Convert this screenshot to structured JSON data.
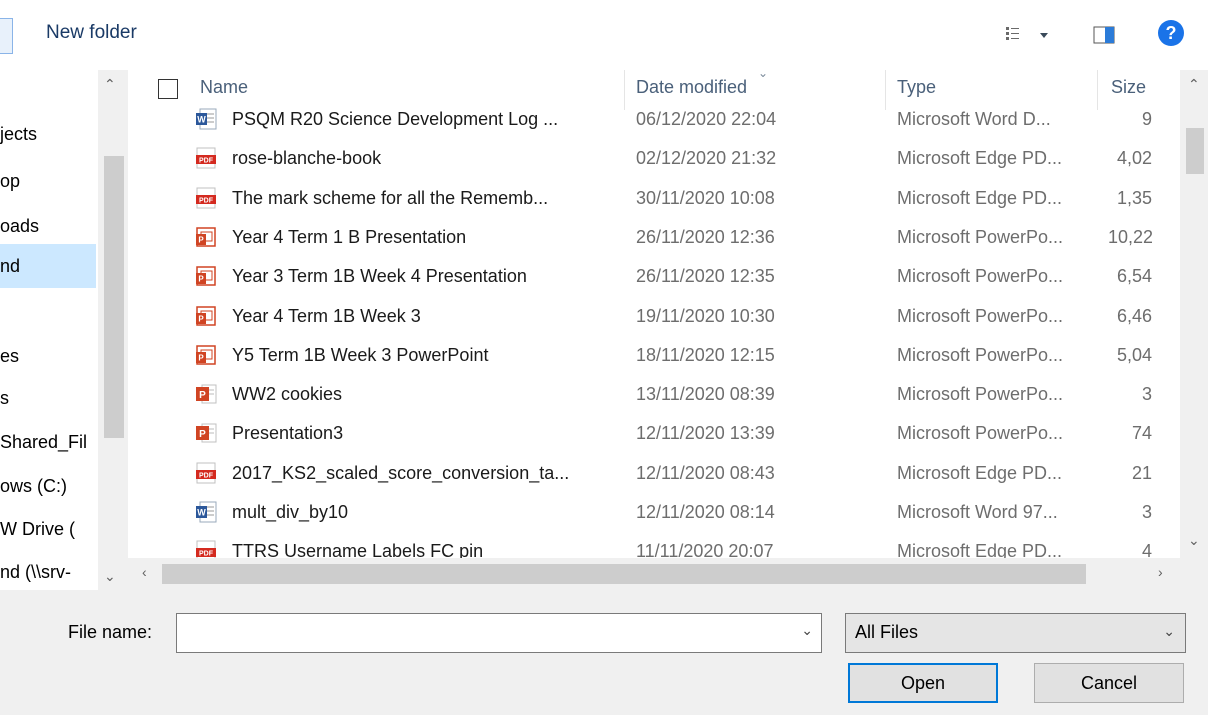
{
  "toolbar": {
    "new_folder_label": "New folder",
    "view_icon": "details-view-icon",
    "preview_icon": "preview-pane-icon",
    "help_icon": "help-icon",
    "help_glyph": "?"
  },
  "nav": {
    "items": [
      {
        "label": "jects",
        "selected": false
      },
      {
        "label": "op",
        "selected": false
      },
      {
        "label": "oads",
        "selected": false
      },
      {
        "label": "nd",
        "selected": true
      },
      {
        "label": "",
        "selected": false
      },
      {
        "label": "es",
        "selected": false
      },
      {
        "label": "s",
        "selected": false
      },
      {
        "label": "Shared_Fil",
        "selected": false
      },
      {
        "label": "ows (C:)",
        "selected": false
      },
      {
        "label": "W Drive (",
        "selected": false
      },
      {
        "label": "nd (\\\\srv-",
        "selected": false
      }
    ]
  },
  "columns": {
    "name": "Name",
    "date": "Date modified",
    "type": "Type",
    "size": "Size"
  },
  "files": [
    {
      "icon": "word",
      "name": "PSQM R20 Science Development Log ...",
      "date": "06/12/2020 22:04",
      "type": "Microsoft Word D...",
      "size": "9"
    },
    {
      "icon": "pdf",
      "name": "rose-blanche-book",
      "date": "02/12/2020 21:32",
      "type": "Microsoft Edge PD...",
      "size": "4,02"
    },
    {
      "icon": "pdf",
      "name": "The mark scheme for all the Rememb...",
      "date": "30/11/2020 10:08",
      "type": "Microsoft Edge PD...",
      "size": "1,35"
    },
    {
      "icon": "pps",
      "name": "Year 4 Term 1 B Presentation",
      "date": "26/11/2020 12:36",
      "type": "Microsoft PowerPo...",
      "size": "10,22"
    },
    {
      "icon": "pps",
      "name": "Year 3 Term 1B Week 4 Presentation",
      "date": "26/11/2020 12:35",
      "type": "Microsoft PowerPo...",
      "size": "6,54"
    },
    {
      "icon": "pps",
      "name": "Year 4 Term 1B Week 3",
      "date": "19/11/2020 10:30",
      "type": "Microsoft PowerPo...",
      "size": "6,46"
    },
    {
      "icon": "pps",
      "name": "Y5 Term 1B Week 3 PowerPoint",
      "date": "18/11/2020 12:15",
      "type": "Microsoft PowerPo...",
      "size": "5,04"
    },
    {
      "icon": "ppt",
      "name": "WW2 cookies",
      "date": "13/11/2020 08:39",
      "type": "Microsoft PowerPo...",
      "size": "3"
    },
    {
      "icon": "ppt",
      "name": "Presentation3",
      "date": "12/11/2020 13:39",
      "type": "Microsoft PowerPo...",
      "size": "74"
    },
    {
      "icon": "pdf",
      "name": "2017_KS2_scaled_score_conversion_ta...",
      "date": "12/11/2020 08:43",
      "type": "Microsoft Edge PD...",
      "size": "21"
    },
    {
      "icon": "word97",
      "name": "mult_div_by10",
      "date": "12/11/2020 08:14",
      "type": "Microsoft Word 97...",
      "size": "3"
    },
    {
      "icon": "pdf",
      "name": "TTRS Username Labels FC pin",
      "date": "11/11/2020 20:07",
      "type": "Microsoft Edge PD...",
      "size": "4"
    }
  ],
  "file_name": {
    "label": "File name:",
    "value": ""
  },
  "file_type": {
    "selected": "All Files"
  },
  "buttons": {
    "open": "Open",
    "cancel": "Cancel"
  },
  "colors": {
    "accent": "#0078d7",
    "selection": "#cce8ff",
    "word_blue": "#2b579a",
    "pdf_red": "#d42a1f",
    "ppt_orange": "#d04423"
  }
}
